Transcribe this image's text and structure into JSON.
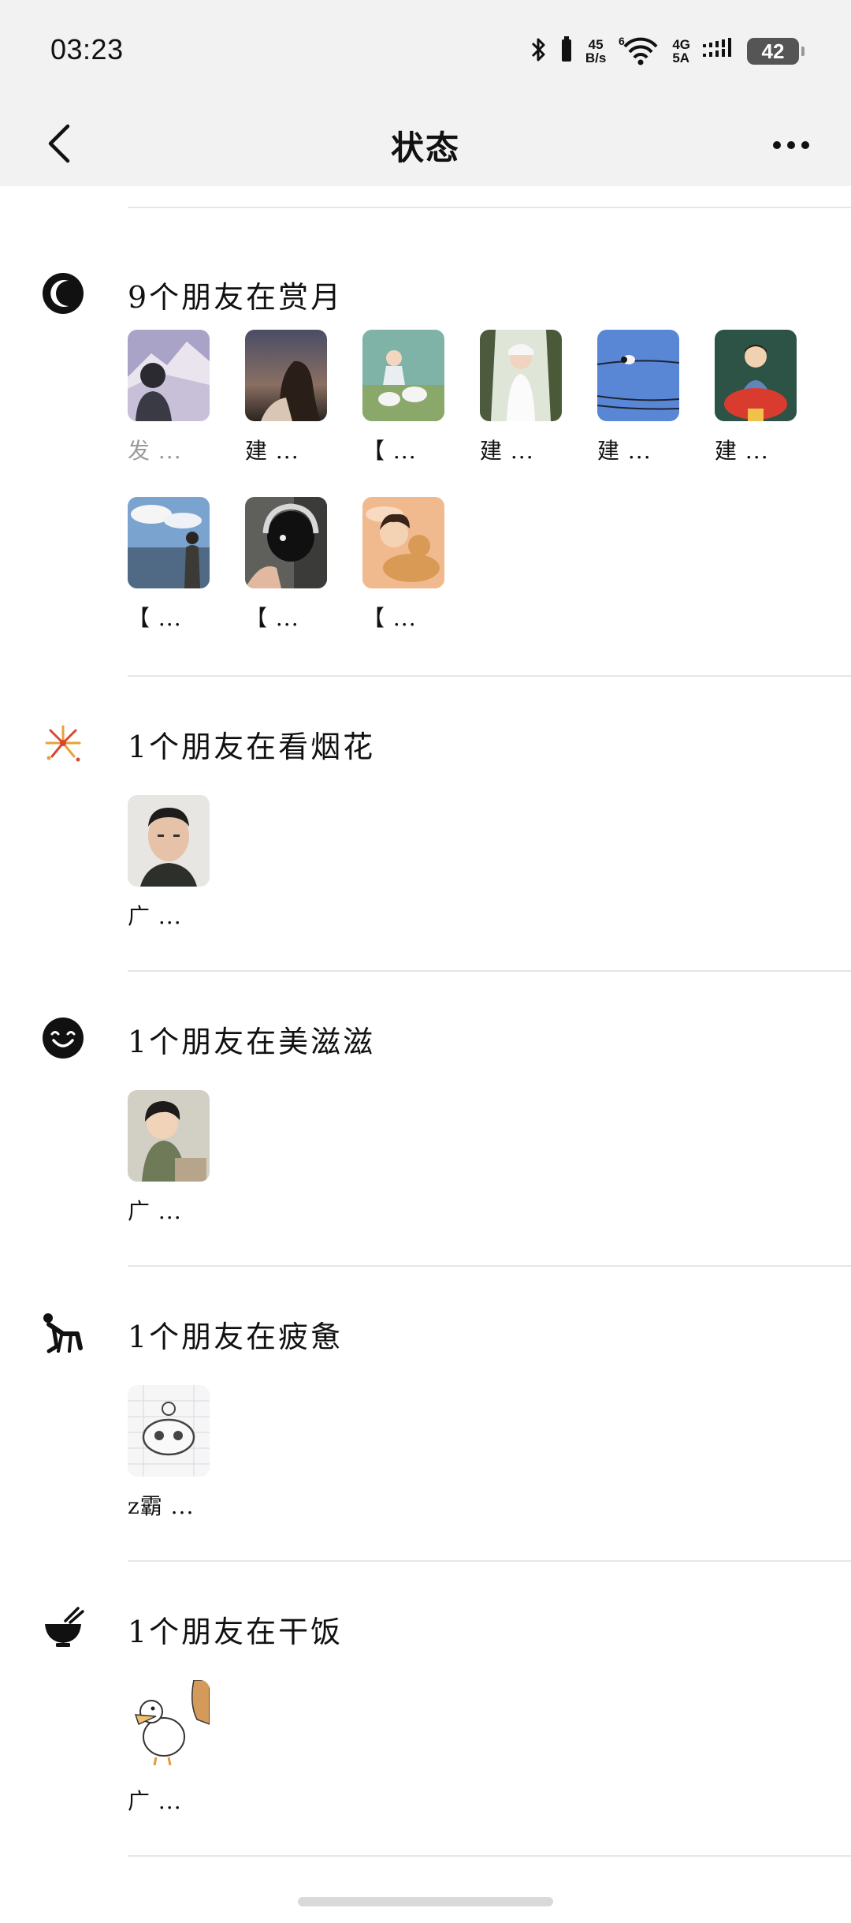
{
  "status_bar": {
    "time": "03:23",
    "net_speed_value": "45",
    "net_speed_unit": "B/s",
    "network_top": "4G",
    "network_bottom": "5A",
    "battery": "42",
    "icons": [
      "bluetooth-icon",
      "vibrate-icon",
      "wifi-icon",
      "signal-icon",
      "battery-icon"
    ]
  },
  "nav": {
    "title": "状态",
    "back_icon": "back-arrow-icon",
    "more_icon": "more-dots-icon"
  },
  "sections": [
    {
      "icon": "moon-face-icon",
      "title": "9个朋友在赏月",
      "friends": [
        {
          "name": "发 ...",
          "dim": true
        },
        {
          "name": "建 ..."
        },
        {
          "name": "【 ..."
        },
        {
          "name": "建 ..."
        },
        {
          "name": "建 ..."
        },
        {
          "name": "建 ..."
        },
        {
          "name": "【 ..."
        },
        {
          "name": "【 ..."
        },
        {
          "name": "【 ..."
        }
      ]
    },
    {
      "icon": "fireworks-icon",
      "title": "1个朋友在看烟花",
      "friends": [
        {
          "name": "广 ..."
        }
      ]
    },
    {
      "icon": "smile-icon",
      "title": "1个朋友在美滋滋",
      "friends": [
        {
          "name": "广 ..."
        }
      ]
    },
    {
      "icon": "tired-person-icon",
      "title": "1个朋友在疲惫",
      "friends": [
        {
          "name": "z霸 ..."
        }
      ]
    },
    {
      "icon": "rice-bowl-icon",
      "title": "1个朋友在干饭",
      "friends": [
        {
          "name": "广 ..."
        }
      ]
    }
  ]
}
